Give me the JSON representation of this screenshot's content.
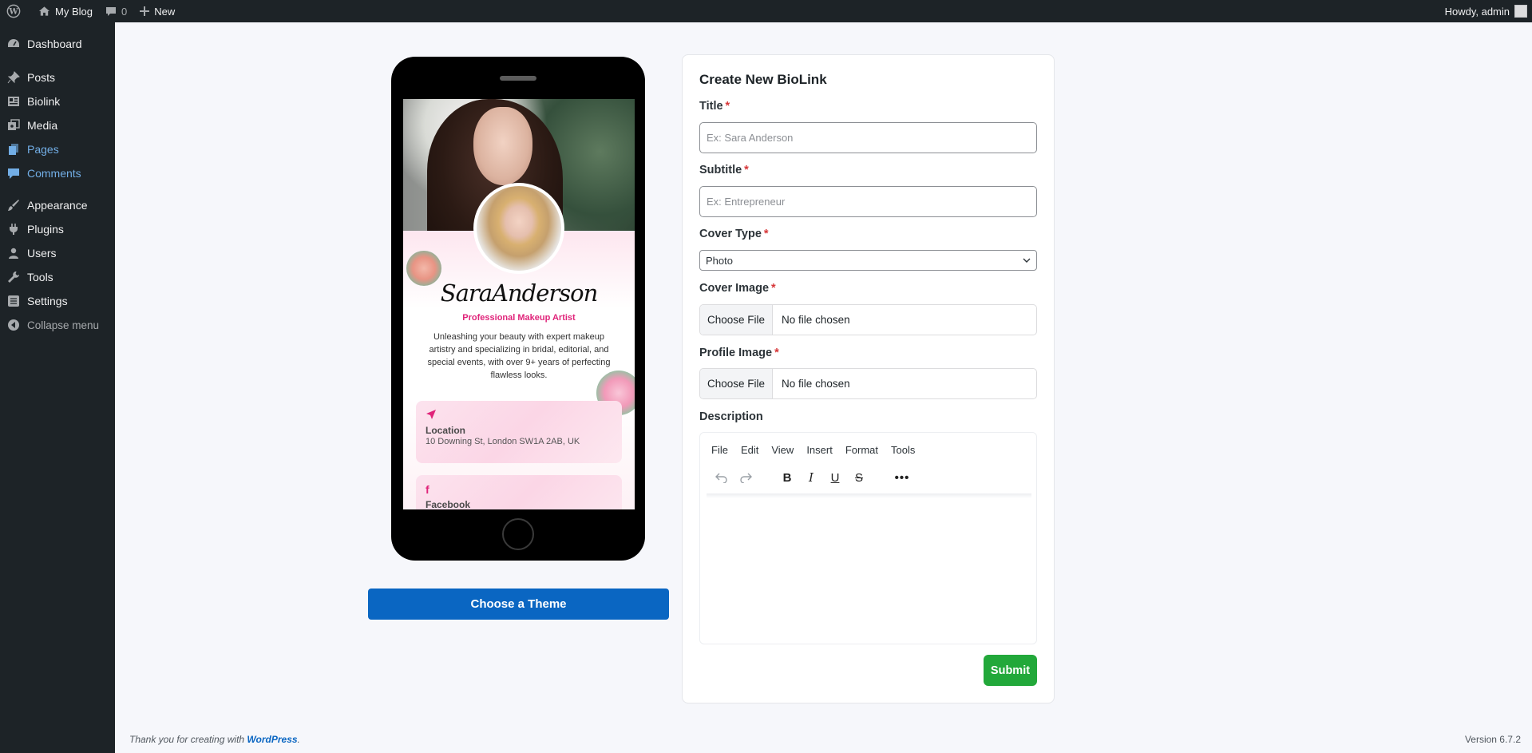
{
  "adminbar": {
    "site_name": "My Blog",
    "comments_count": "0",
    "new_label": "New",
    "howdy": "Howdy, admin"
  },
  "sidebar": {
    "items": [
      {
        "label": "Dashboard",
        "icon": "dashboard-icon"
      },
      {
        "label": "Posts",
        "icon": "pin-icon"
      },
      {
        "label": "Biolink",
        "icon": "biolink-icon"
      },
      {
        "label": "Media",
        "icon": "media-icon"
      },
      {
        "label": "Pages",
        "icon": "pages-icon"
      },
      {
        "label": "Comments",
        "icon": "comment-icon"
      },
      {
        "label": "Appearance",
        "icon": "brush-icon"
      },
      {
        "label": "Plugins",
        "icon": "plug-icon"
      },
      {
        "label": "Users",
        "icon": "user-icon"
      },
      {
        "label": "Tools",
        "icon": "wrench-icon"
      },
      {
        "label": "Settings",
        "icon": "settings-icon"
      },
      {
        "label": "Collapse menu",
        "icon": "collapse-icon"
      }
    ]
  },
  "preview": {
    "name": "SaraAnderson",
    "subtitle": "Professional Makeup Artist",
    "description": "Unleashing your beauty with expert makeup artistry and specializing in bridal, editorial, and special events, with over 9+ years of perfecting flawless looks.",
    "cards": [
      {
        "icon": "location-arrow-icon",
        "title": "Location",
        "text": "10 Downing St, London SW1A 2AB, UK"
      },
      {
        "icon": "facebook-icon",
        "title": "Facebook",
        "text": ""
      }
    ]
  },
  "theme_button": "Choose a Theme",
  "form": {
    "title": "Create New BioLink",
    "title_label": "Title",
    "title_placeholder": "Ex: Sara Anderson",
    "subtitle_label": "Subtitle",
    "subtitle_placeholder": "Ex: Entrepreneur",
    "cover_type_label": "Cover Type",
    "cover_type_value": "Photo",
    "cover_image_label": "Cover Image",
    "profile_image_label": "Profile Image",
    "choose_file": "Choose File",
    "no_file": "No file chosen",
    "description_label": "Description",
    "editor_menu": [
      "File",
      "Edit",
      "View",
      "Insert",
      "Format",
      "Tools"
    ],
    "submit": "Submit",
    "required_mark": "*"
  },
  "footer": {
    "thanks": "Thank you for creating with ",
    "wp_link": "WordPress",
    "thanks_end": ".",
    "version": "Version 6.7.2"
  },
  "colors": {
    "admin_dark": "#1d2327",
    "accent_blue": "#0a66c2",
    "submit_green": "#22a83a",
    "pink": "#e0247a"
  }
}
